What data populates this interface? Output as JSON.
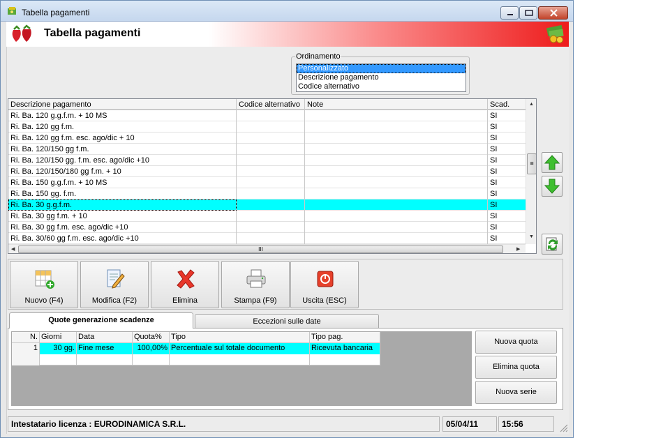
{
  "window": {
    "title": "Tabella pagamenti"
  },
  "header": {
    "title": "Tabella pagamenti"
  },
  "ordinamento": {
    "legend": "Ordinamento",
    "options": [
      "Personalizzato",
      "Descrizione pagamento",
      "Codice alternativo"
    ],
    "selected": "Personalizzato"
  },
  "grid": {
    "columns": [
      "Descrizione pagamento",
      "Codice alternativo",
      "Note",
      "Scad."
    ],
    "rows": [
      [
        "Ri. Ba. 120 g.g.f.m. + 10 MS",
        "",
        "",
        "SI"
      ],
      [
        "Ri. Ba. 120 gg f.m.",
        "",
        "",
        "SI"
      ],
      [
        "Ri. Ba. 120 gg f.m. esc. ago/dic + 10",
        "",
        "",
        "SI"
      ],
      [
        "Ri. Ba. 120/150 gg f.m.",
        "",
        "",
        "SI"
      ],
      [
        "Ri. Ba. 120/150 gg. f.m. esc. ago/dic +10",
        "",
        "",
        "SI"
      ],
      [
        "Ri. Ba. 120/150/180 gg f.m. + 10",
        "",
        "",
        "SI"
      ],
      [
        "Ri. Ba. 150 g.g.f.m. + 10 MS",
        "",
        "",
        "SI"
      ],
      [
        "Ri. Ba. 150 gg. f.m.",
        "",
        "",
        "SI"
      ],
      [
        "Ri. Ba. 30 g.g.f.m.",
        "",
        "",
        "SI"
      ],
      [
        "Ri. Ba. 30 gg f.m. + 10",
        "",
        "",
        "SI"
      ],
      [
        "Ri. Ba. 30 gg f.m. esc. ago/dic +10",
        "",
        "",
        "SI"
      ],
      [
        "Ri. Ba. 30/60 gg f.m. esc. ago/dic +10",
        "",
        "",
        "SI"
      ]
    ],
    "selected_row": "Ri. Ba. 30 g.g.f.m.",
    "scroll_grip": "≡",
    "hscroll_grip": "III"
  },
  "toolbar": {
    "nuovo": "Nuovo (F4)",
    "modifica": "Modifica (F2)",
    "elimina": "Elimina",
    "stampa": "Stampa (F9)",
    "uscita": "Uscita (ESC)"
  },
  "tabs": {
    "active": "Quote generazione scadenze",
    "inactive": "Eccezioni sulle date"
  },
  "quote": {
    "columns": [
      "N.",
      "Giorni",
      "Data",
      "Quota%",
      "Tipo",
      "Tipo pag."
    ],
    "rows": [
      [
        "1",
        "30 gg.",
        "Fine mese",
        "100,00%",
        "Percentuale sul totale documento",
        "Ricevuta bancaria"
      ]
    ]
  },
  "side_buttons": {
    "nuova_quota": "Nuova quota",
    "elimina_quota": "Elimina quota",
    "nuova_serie": "Nuova serie"
  },
  "status": {
    "license": "Intestatario licenza : EURODINAMICA S.R.L.",
    "date": "05/04/11",
    "time": "15:56"
  },
  "colors": {
    "selection_cyan": "#00ffff",
    "header_red": "#ee1c1c",
    "listbox_select": "#3399ff"
  },
  "icons": [
    "app-icon",
    "strawberry-icon",
    "money-icon",
    "minimize-icon",
    "maximize-icon",
    "close-icon",
    "arrow-up-icon",
    "arrow-down-icon",
    "refresh-icon",
    "new-table-icon",
    "edit-icon",
    "delete-x-icon",
    "printer-icon",
    "exit-icon"
  ]
}
